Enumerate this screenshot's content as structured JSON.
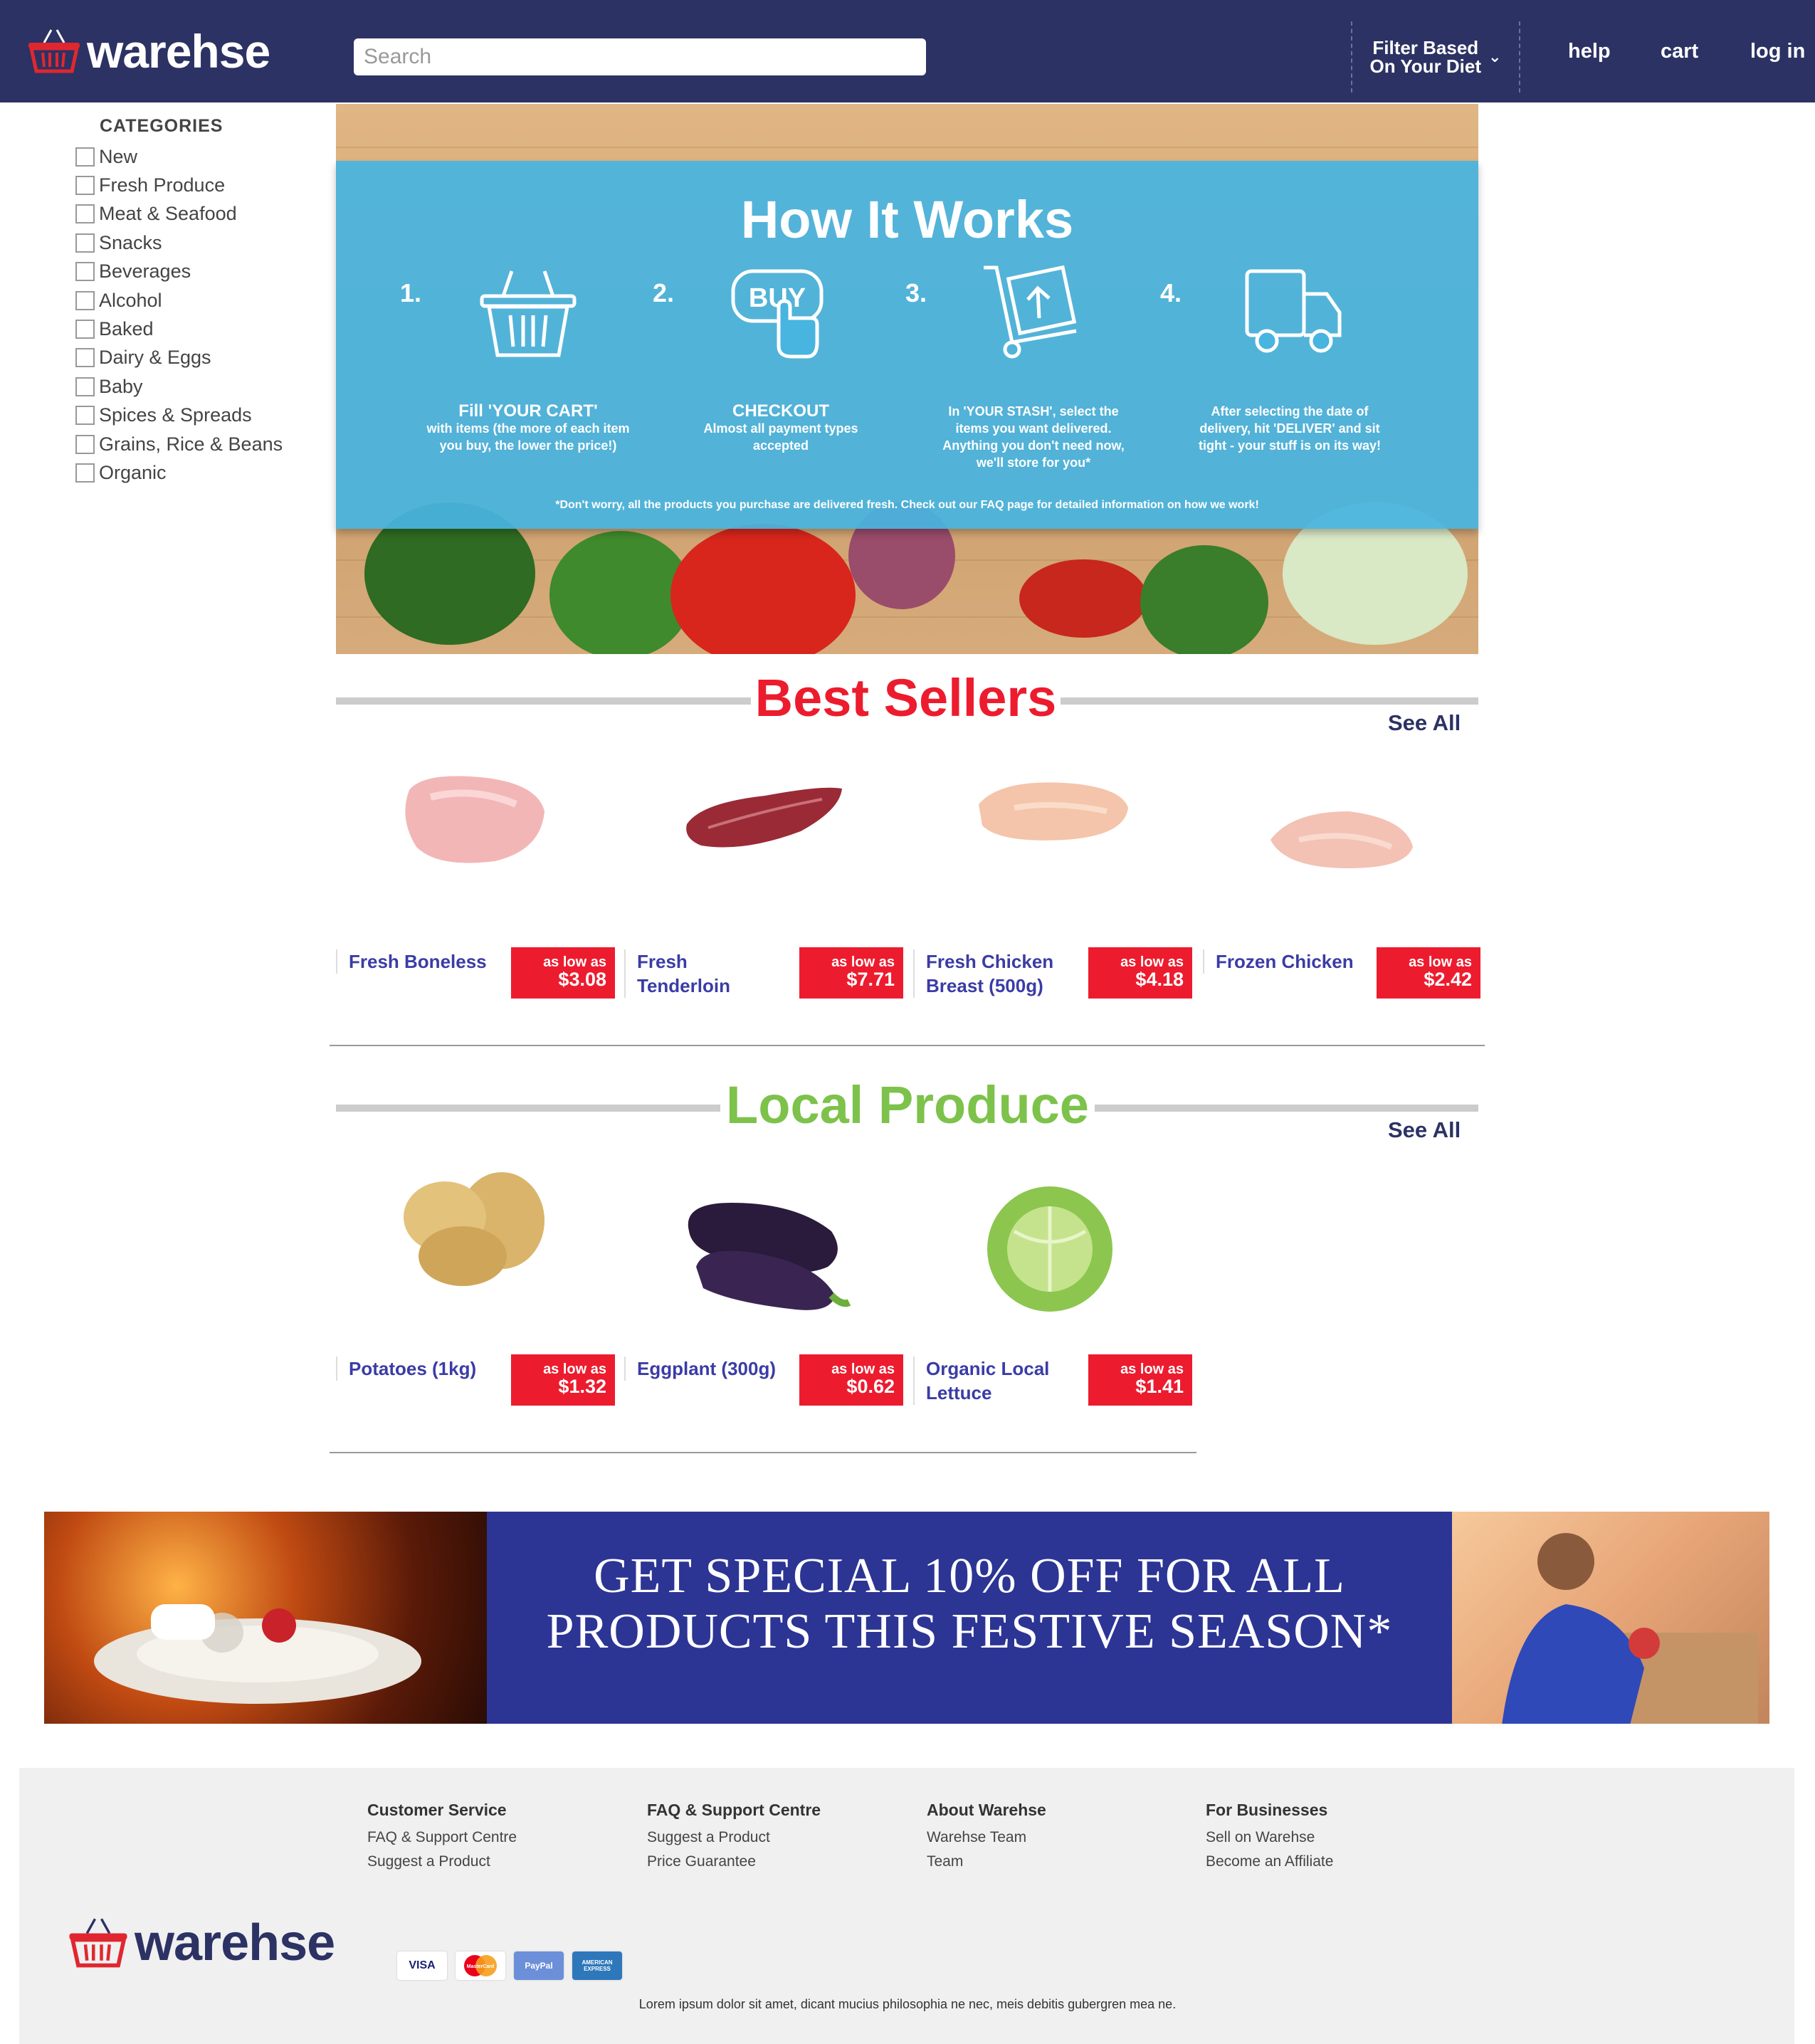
{
  "header": {
    "logo_text": "warehse",
    "search_placeholder": "Search",
    "diet_line1": "Filter Based",
    "diet_line2": "On Your Diet",
    "nav": [
      "help",
      "cart",
      "log in"
    ]
  },
  "sidebar": {
    "title": "CATEGORIES",
    "items": [
      "New",
      "Fresh Produce",
      "Meat & Seafood",
      "Snacks",
      "Beverages",
      "Alcohol",
      "Baked",
      "Dairy & Eggs",
      "Baby",
      "Spices & Spreads",
      "Grains, Rice & Beans",
      "Organic"
    ]
  },
  "how_it_works": {
    "title": "How It Works",
    "steps": [
      {
        "num": "1.",
        "lead": "Fill 'YOUR CART'",
        "text": "with items (the more of each item you buy, the lower the price!)",
        "icon": "basket-icon"
      },
      {
        "num": "2.",
        "lead": "CHECKOUT",
        "text": "Almost all payment types accepted",
        "icon": "buy-click-icon"
      },
      {
        "num": "3.",
        "lead": "",
        "text": "In 'YOUR STASH', select the items you want delivered. Anything you don't need now, we'll store for you*",
        "icon": "hand-truck-icon"
      },
      {
        "num": "4.",
        "lead": "",
        "text": "After selecting the date of delivery, hit 'DELIVER' and sit tight - your stuff is on its way!",
        "icon": "delivery-truck-icon"
      }
    ],
    "note": "*Don't worry, all the products you purchase are delivered fresh. Check out our FAQ page for detailed information on how we work!"
  },
  "best_sellers": {
    "title": "Best Sellers",
    "see_all": "See All",
    "products": [
      {
        "name": "Fresh Boneless",
        "as_low_as": "as low as",
        "price": "$3.08"
      },
      {
        "name": "Fresh Tenderloin",
        "as_low_as": "as low as",
        "price": "$7.71"
      },
      {
        "name": "Fresh Chicken Breast (500g)",
        "as_low_as": "as low as",
        "price": "$4.18"
      },
      {
        "name": "Frozen Chicken",
        "as_low_as": "as low as",
        "price": "$2.42"
      }
    ]
  },
  "local_produce": {
    "title": "Local Produce",
    "see_all": "See All",
    "products": [
      {
        "name": "Potatoes (1kg)",
        "as_low_as": "as low as",
        "price": "$1.32"
      },
      {
        "name": "Eggplant (300g)",
        "as_low_as": "as low as",
        "price": "$0.62"
      },
      {
        "name": "Organic Local Lettuce",
        "as_low_as": "as low as",
        "price": "$1.41"
      }
    ]
  },
  "banner": {
    "line1": "GET SPECIAL 10% OFF FOR ALL",
    "line2": "PRODUCTS THIS FESTIVE SEASON*"
  },
  "footer": {
    "columns": [
      {
        "title": "Customer Service",
        "links": [
          "FAQ & Support Centre",
          "Suggest a Product"
        ]
      },
      {
        "title": "FAQ & Support Centre",
        "links": [
          "Suggest a Product",
          "Price Guarantee"
        ]
      },
      {
        "title": "About Warehse",
        "links": [
          "Warehse Team",
          "Team"
        ]
      },
      {
        "title": "For Businesses",
        "links": [
          "Sell on Warehse",
          "Become an Affiliate"
        ]
      }
    ],
    "logo_text": "warehse",
    "payments": [
      "VISA",
      "MasterCard",
      "PayPal",
      "AMERICAN EXPRESS"
    ],
    "tagline": "Lorem ipsum dolor sit amet, dicant mucius philosophia ne nec, meis debitis gubergren mea ne."
  },
  "colors": {
    "header_bg": "#2c3263",
    "accent_red": "#ec1c2e",
    "produce_green": "#7dc24b",
    "how_blue": "#48b4e0",
    "banner_blue": "#2c3594",
    "product_link": "#3b3ca6"
  }
}
